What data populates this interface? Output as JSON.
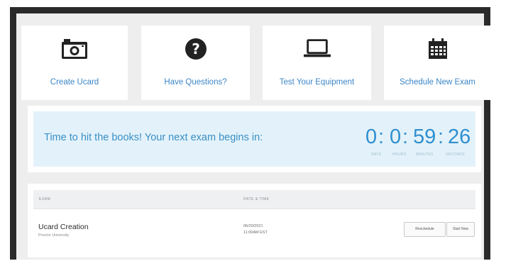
{
  "actions": [
    {
      "label": "Create Ucard",
      "icon": "camera-icon"
    },
    {
      "label": "Have Questions?",
      "icon": "question-circle-icon"
    },
    {
      "label": "Test Your Equipment",
      "icon": "laptop-icon"
    },
    {
      "label": "Schedule New Exam",
      "icon": "calendar-icon"
    }
  ],
  "banner": {
    "message": "Time to hit the books! Your next exam begins in:",
    "countdown": {
      "days": "0",
      "hours": "0",
      "minutes": "59",
      "seconds": "26",
      "sep": ":",
      "labels": [
        "DAYS",
        "HOURS",
        "MINUTES",
        "SECONDS"
      ]
    }
  },
  "exams": {
    "columns": [
      "EXAM",
      "DATE & TIME"
    ],
    "rows": [
      {
        "name": "Ucard Creation",
        "institution": "Proctor University",
        "date": "06/20/2021",
        "time": "11:00AM EST",
        "buttons": [
          "Reschedule",
          "Start Now"
        ]
      }
    ]
  },
  "colors": {
    "accent": "#3b86c6",
    "banner_bg": "#e3f2fa",
    "countdown": "#2f8fcf"
  }
}
